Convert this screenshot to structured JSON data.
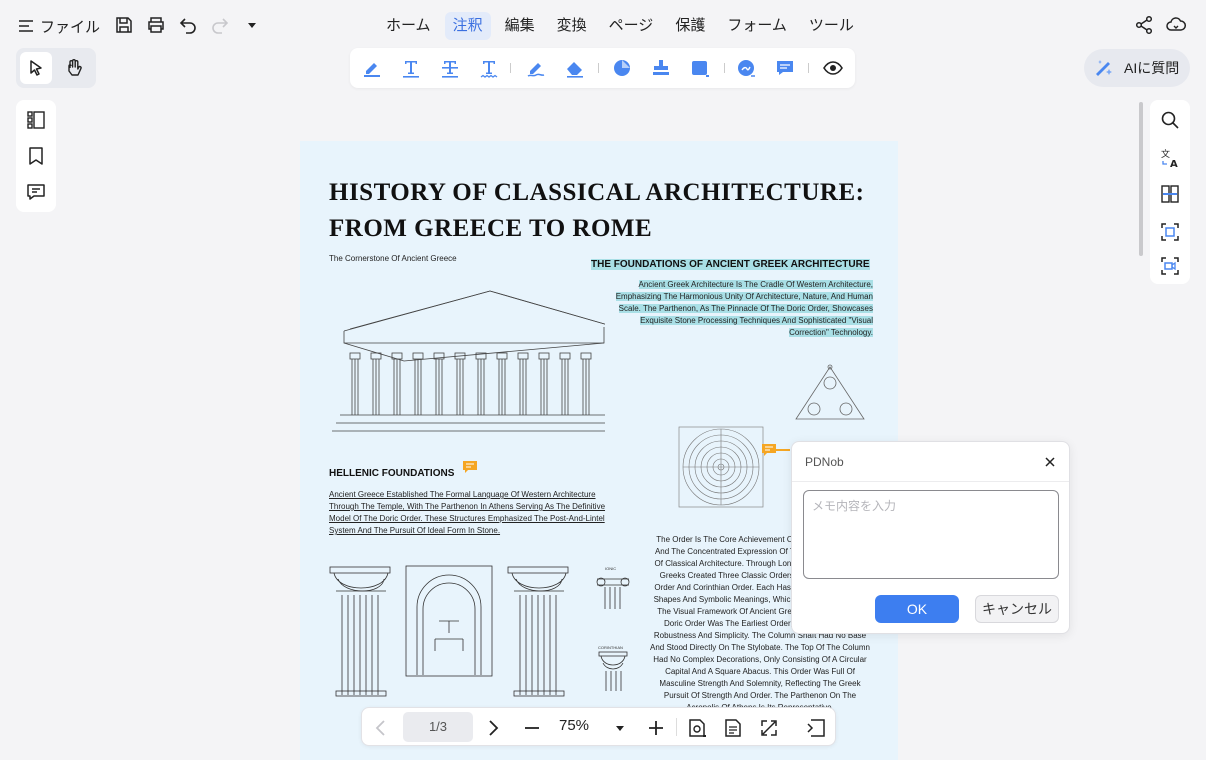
{
  "menu": {
    "file": "ファイル",
    "items": [
      "ホーム",
      "注釈",
      "編集",
      "変換",
      "ページ",
      "保護",
      "フォーム",
      "ツール"
    ],
    "active_index": 1
  },
  "ai_button": "AIに質問",
  "document": {
    "title_line1": "HISTORY OF CLASSICAL  ARCHITECTURE:",
    "title_line2": "FROM GREECE TO ROME",
    "subtitle": "The Cornerstone Of Ancient Greece",
    "section_heading": "THE FOUNDATIONS OF ANCIENT GREEK ARCHITECTURE",
    "para1": "Ancient Greek Architecture Is The Cradle Of Western Architecture, Emphasizing The Harmonious Unity Of Architecture, Nature, And Human Scale. The Parthenon, As The Pinnacle Of The Doric Order, Showcases Exquisite Stone Processing Techniques And Sophisticated \"Visual Correction\" Technology.",
    "hellenic_heading": "HELLENIC FOUNDATIONS",
    "para2": "Ancient Greece Established The Formal Language Of Western Architecture Through The Temple, With The Parthenon In Athens Serving As The Definitive Model Of The Doric Order. These Structures Emphasized The Post-And-Lintel System And The Pursuit Of Ideal Form In Stone.",
    "para3": "The Order Is The Core Achievement Of Greek Architecture And The Concentrated Expression Of The Order Aesthetics Of Classical Architecture. Through Long-Term Practice, The Greeks Created Three Classic Orders: Doric Order, Ionic Order And Corinthian Order. Each Has Its Own Proportions, Shapes And Symbolic Meanings, Which Together Constitute The Visual Framework Of Ancient Greek Architecture. The Doric Order Was The Earliest Order, Characterized By Robustness And Simplicity. The Column Shaft Had No Base And Stood Directly On The Stylobate. The Top Of The Column Had No Complex Decorations, Only Consisting Of A Circular Capital And A Square Abacus. This Order Was Full Of Masculine Strength And Solemnity, Reflecting The Greek Pursuit Of Strength And Order. The Parthenon On The Acropolis Of Athens Is Its Representative.",
    "ionic_label": "IONIC",
    "corinthian_label": "CORINTHIAN"
  },
  "popup": {
    "title": "PDNob",
    "placeholder": "メモ内容を入力",
    "ok": "OK",
    "cancel": "キャンセル"
  },
  "bottom": {
    "page": "1/3",
    "zoom": "75%"
  },
  "colors": {
    "accent": "#3d7ef0",
    "highlight": "#a9dfe6",
    "page_bg": "#e8f4fc",
    "comment": "#f5a623"
  }
}
